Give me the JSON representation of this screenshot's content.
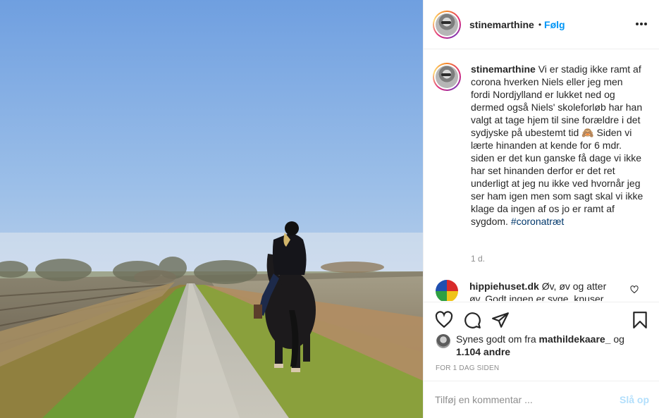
{
  "header": {
    "username": "stinemarthine",
    "separator": "•",
    "follow_label": "Følg"
  },
  "caption": {
    "username": "stinemarthine",
    "text_before_emoji": "Vi er stadig ikke ramt af corona hverken Niels eller jeg men fordi Nordjylland er lukket ned og dermed også Niels' skoleforløb har han valgt at tage hjem til sine forældre i det sydjyske på ubestemt tid",
    "emoji": "🙈",
    "text_after_emoji": "Siden vi lærte hinanden at kende for 6 mdr. siden er det kun ganske få dage vi ikke har set hinanden derfor er det ret underligt at jeg nu ikke ved hvornår jeg ser ham igen men som sagt skal vi ikke klage da ingen af os jo er ramt af sygdom.",
    "hashtag": "#coronatræt",
    "time": "1 d."
  },
  "comment": {
    "username": "hippiehuset.dk",
    "text": "Øv, øv og atter øv. Godt ingen er syge, knuser"
  },
  "likes": {
    "prefix": "Synes godt om fra",
    "user": "mathildekaare_",
    "joiner": "og",
    "others": "1.104 andre"
  },
  "timestamp": "For 1 dag siden",
  "add_comment": {
    "placeholder": "Tilføj en kommentar ...",
    "post_label": "Slå op"
  },
  "colors": {
    "follow_blue": "#0095f6",
    "post_disabled": "#b2dffc",
    "hashtag": "#00376b",
    "muted": "#8e8e8e"
  },
  "icons": {
    "like": "heart-icon",
    "comment": "comment-icon",
    "share": "paper-plane-icon",
    "save": "bookmark-icon",
    "more": "more-options-icon"
  }
}
